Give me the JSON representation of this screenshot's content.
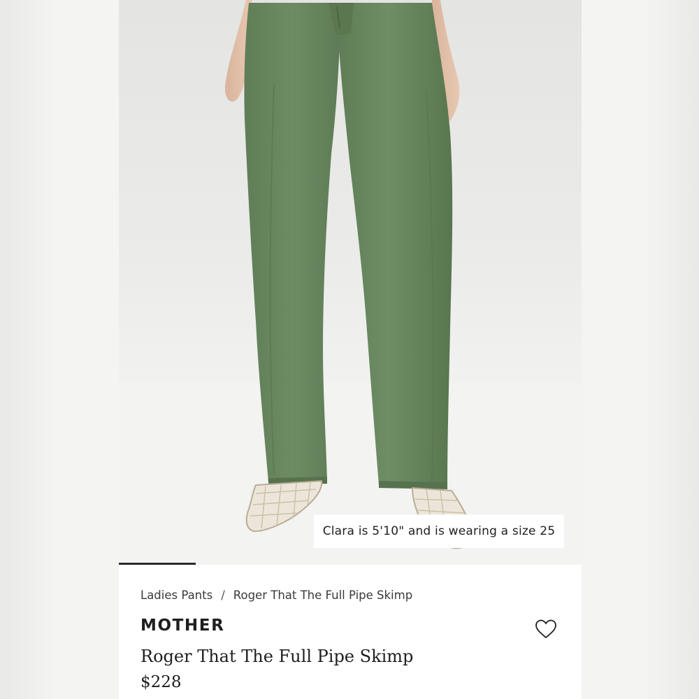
{
  "gallery": {
    "caption": "Clara is 5'10\" and is wearing a size 25",
    "progress": 0.166
  },
  "breadcrumb": {
    "category": "Ladies Pants",
    "separator": "/",
    "current": "Roger That The Full Pipe Skimp"
  },
  "product": {
    "brand": "MOTHER",
    "name": "Roger That The Full Pipe Skimp",
    "price": "$228"
  },
  "icons": {
    "favorite": "heart-outline-icon"
  },
  "colors": {
    "pants": "#6b8a62",
    "text": "#1e1e1e",
    "background": "#ffffff"
  }
}
